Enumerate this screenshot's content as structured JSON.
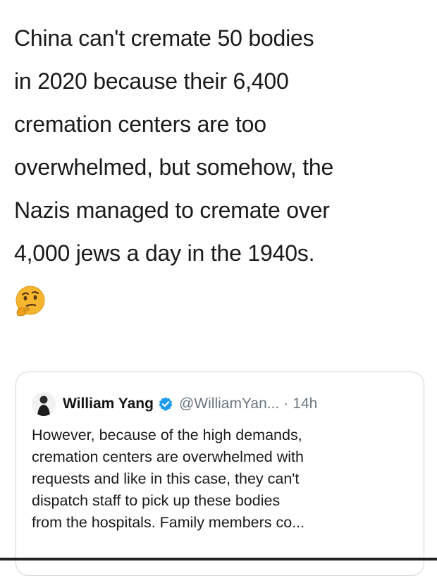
{
  "tweet": {
    "lines": [
      "China can't cremate 50 bodies",
      "in 2020 because their 6,400",
      "cremation centers are too",
      "overwhelmed, but somehow, the",
      "Nazis managed to cremate over",
      "4,000 jews a day in the 1940s."
    ],
    "emoji": "thinking-face-emoji"
  },
  "quote": {
    "author_name": "William Yang",
    "verified_icon": "verified-badge-icon",
    "handle": "@WilliamYan...",
    "separator": "·",
    "time": "14h",
    "lines": [
      "However, because of the high demands,",
      "cremation centers are overwhelmed with",
      "requests and like in this case, they can't",
      "dispatch staff to pick up these bodies",
      "from the hospitals. Family members co..."
    ]
  },
  "colors": {
    "text": "#1a1a1a",
    "muted": "#6b7680",
    "verified": "#1d9bf0",
    "card_border": "#cfd6dc",
    "emoji": "#f5b52e"
  }
}
